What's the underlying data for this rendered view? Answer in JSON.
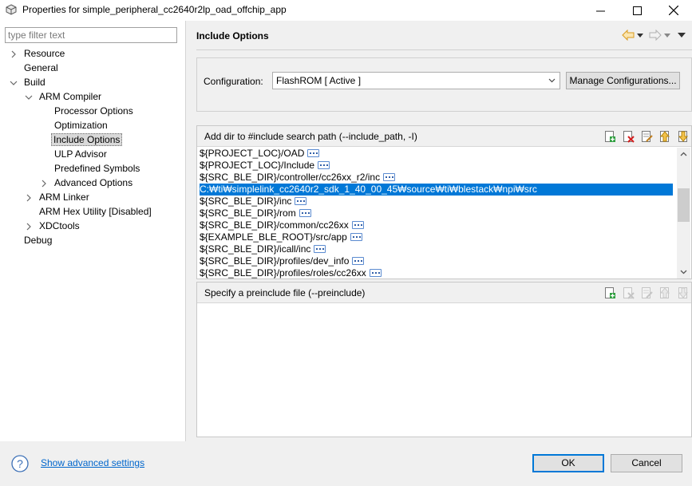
{
  "window": {
    "title": "Properties for simple_peripheral_cc2640r2lp_oad_offchip_app"
  },
  "filter": {
    "placeholder": "type filter text"
  },
  "tree": {
    "resource": "Resource",
    "general": "General",
    "build": "Build",
    "arm_compiler": "ARM Compiler",
    "processor_options": "Processor Options",
    "optimization": "Optimization",
    "include_options": "Include Options",
    "ulp_advisor": "ULP Advisor",
    "predefined_symbols": "Predefined Symbols",
    "advanced_options": "Advanced Options",
    "arm_linker": "ARM Linker",
    "arm_hex_utility": "ARM Hex Utility  [Disabled]",
    "xdctools": "XDCtools",
    "debug": "Debug"
  },
  "page": {
    "title": "Include Options"
  },
  "configuration": {
    "label": "Configuration:",
    "value": "FlashROM  [ Active ]",
    "manage_label": "Manage Configurations..."
  },
  "include_paths": {
    "title": "Add dir to #include search path (--include_path, -I)",
    "items": [
      "${PROJECT_LOC}/OAD",
      "${PROJECT_LOC}/Include",
      "${SRC_BLE_DIR}/controller/cc26xx_r2/inc",
      "C:₩ti₩simplelink_cc2640r2_sdk_1_40_00_45₩source₩ti₩blestack₩npi₩src",
      "${SRC_BLE_DIR}/inc",
      "${SRC_BLE_DIR}/rom",
      "${SRC_BLE_DIR}/common/cc26xx",
      "${EXAMPLE_BLE_ROOT}/src/app",
      "${SRC_BLE_DIR}/icall/inc",
      "${SRC_BLE_DIR}/profiles/dev_info",
      "${SRC_BLE_DIR}/profiles/roles/cc26xx"
    ],
    "selected_index": 3
  },
  "preinclude": {
    "title": "Specify a preinclude file (--preinclude)"
  },
  "footer": {
    "advanced_link": "Show advanced settings",
    "ok_label": "OK",
    "cancel_label": "Cancel"
  },
  "colors": {
    "selection": "#0078d7",
    "link": "#0066cc",
    "nav_arrow": "#f0a020"
  }
}
